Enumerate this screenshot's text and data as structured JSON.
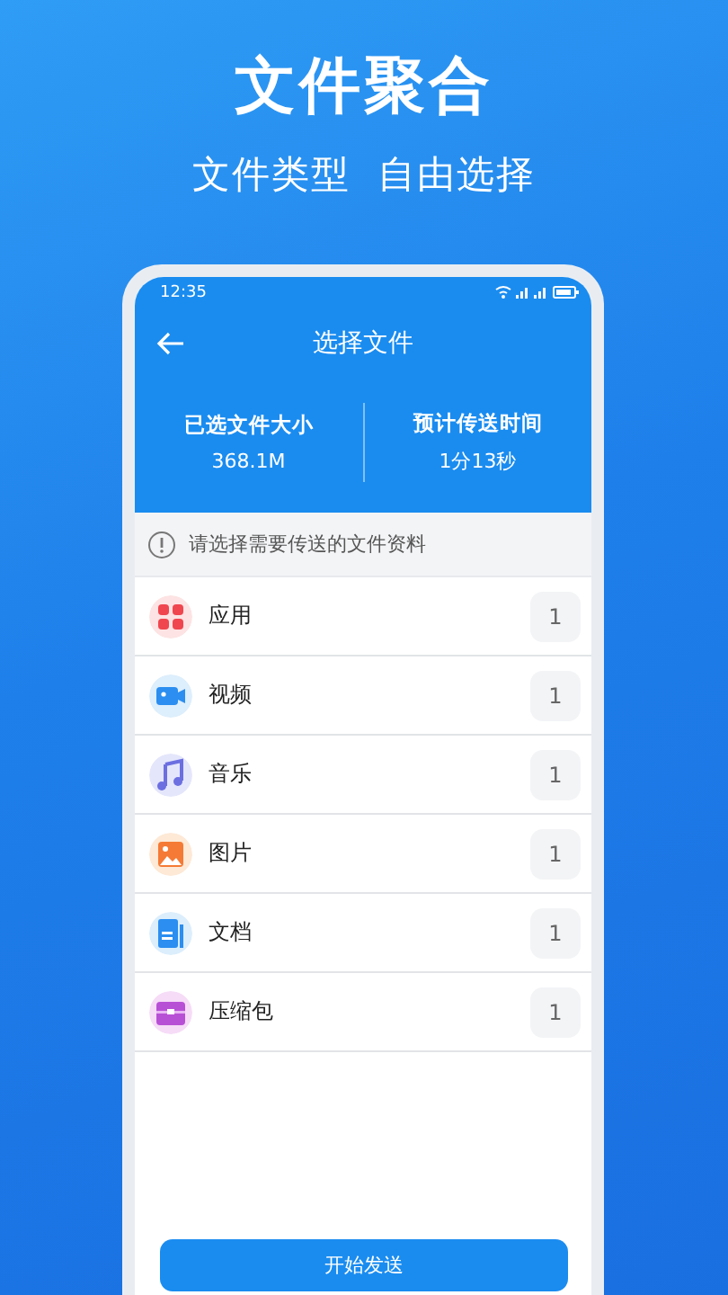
{
  "promo": {
    "headline": "文件聚合",
    "subheadline": "文件类型  自由选择"
  },
  "status_bar": {
    "time": "12:35"
  },
  "app_bar": {
    "title": "选择文件"
  },
  "stats": [
    {
      "label": "已选文件大小",
      "value": "368.1M"
    },
    {
      "label": "预计传送时间",
      "value": "1分13秒"
    }
  ],
  "notice": "请选择需要传送的文件资料",
  "file_types": [
    {
      "kind": "app",
      "label": "应用",
      "count": "1"
    },
    {
      "kind": "video",
      "label": "视频",
      "count": "1"
    },
    {
      "kind": "music",
      "label": "音乐",
      "count": "1"
    },
    {
      "kind": "image",
      "label": "图片",
      "count": "1"
    },
    {
      "kind": "document",
      "label": "文档",
      "count": "1"
    },
    {
      "kind": "archive",
      "label": "压缩包",
      "count": "1"
    }
  ],
  "send_button": "开始发送"
}
